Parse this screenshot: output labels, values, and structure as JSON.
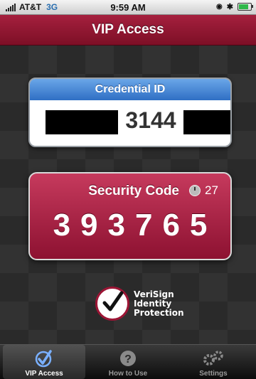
{
  "status": {
    "carrier": "AT&T",
    "network": "3G",
    "time": "9:59 AM"
  },
  "nav": {
    "title": "VIP Access"
  },
  "credential": {
    "header": "Credential ID",
    "visible_digits": "3144"
  },
  "security": {
    "header": "Security Code",
    "seconds_left": "27",
    "code": "393765"
  },
  "logo": {
    "line1": "VeriSign",
    "line2": "Identity",
    "line3": "Protection"
  },
  "tabs": [
    {
      "label": "VIP Access",
      "icon": "check-icon"
    },
    {
      "label": "How to Use",
      "icon": "question-icon"
    },
    {
      "label": "Settings",
      "icon": "gears-icon"
    }
  ],
  "colors": {
    "brand": "#8d1131",
    "credential_header": "#2f6fc4"
  }
}
